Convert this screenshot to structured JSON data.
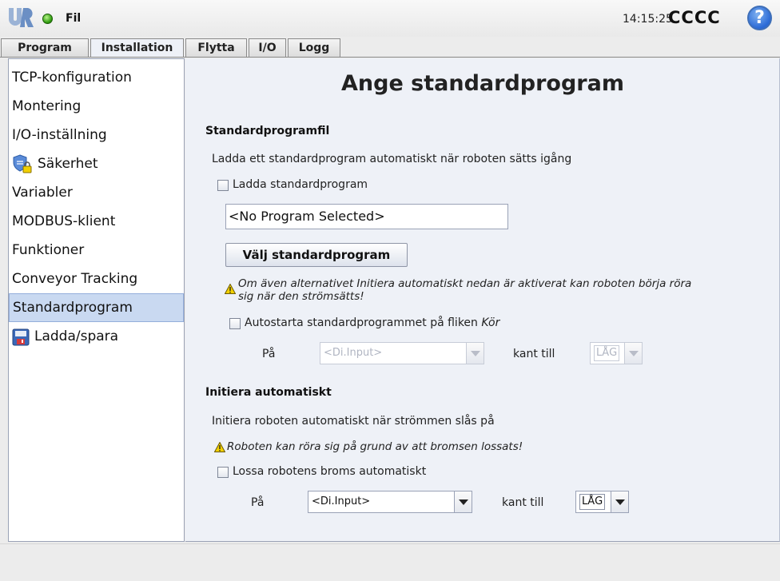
{
  "topbar": {
    "file_menu": "Fil",
    "clock": "14:15:25",
    "robot_name": "CCCC",
    "help_icon": "?"
  },
  "tabs": [
    {
      "label": "Program",
      "active": false
    },
    {
      "label": "Installation",
      "active": true
    },
    {
      "label": "Flytta",
      "active": false
    },
    {
      "label": "I/O",
      "active": false
    },
    {
      "label": "Logg",
      "active": false
    }
  ],
  "sidebar": {
    "items": [
      {
        "label": "TCP-konfiguration"
      },
      {
        "label": "Montering"
      },
      {
        "label": "I/O-inställning"
      },
      {
        "label": "Säkerhet",
        "icon": "shield-lock-icon"
      },
      {
        "label": "Variabler"
      },
      {
        "label": "MODBUS-klient"
      },
      {
        "label": "Funktioner"
      },
      {
        "label": "Conveyor Tracking"
      },
      {
        "label": "Standardprogram",
        "selected": true
      },
      {
        "label": "Ladda/spara",
        "icon": "floppy-disk-icon"
      }
    ]
  },
  "main": {
    "title": "Ange standardprogram",
    "default_file": {
      "heading": "Standardprogramfil",
      "description": "Ladda ett standardprogram automatiskt när roboten sätts igång",
      "load_checkbox_label": "Ladda standardprogram",
      "load_checked": false,
      "file_value": "<No Program Selected>",
      "choose_button": "Välj standardprogram",
      "warning_line1": "Om även alternativet Initiera automatiskt nedan är aktiverat kan roboten börja röra",
      "warning_line2": "sig när den strömsätts!",
      "autostart_label": "Autostarta standardprogrammet på fliken ",
      "autostart_label_em": "Kör",
      "autostart_checked": false,
      "on_label": "På",
      "input_value": "<Di.Input>",
      "edge_label": "kant till",
      "level_value": "LÅG"
    },
    "auto_init": {
      "heading": "Initiera automatiskt",
      "description": "Initiera roboten automatiskt när strömmen slås på",
      "warning": "Roboten kan röra sig på grund av att bromsen lossats!",
      "brake_label": "Lossa robotens broms automatiskt",
      "brake_checked": false,
      "on_label": "På",
      "input_value": "<Di.Input>",
      "edge_label": "kant till",
      "level_value": "LÅG"
    }
  },
  "colors": {
    "accent_selected": "#c9d9f1",
    "status_green": "#2f9b0f",
    "help_blue": "#2b6ad6",
    "warning_yellow": "#f2d000"
  }
}
